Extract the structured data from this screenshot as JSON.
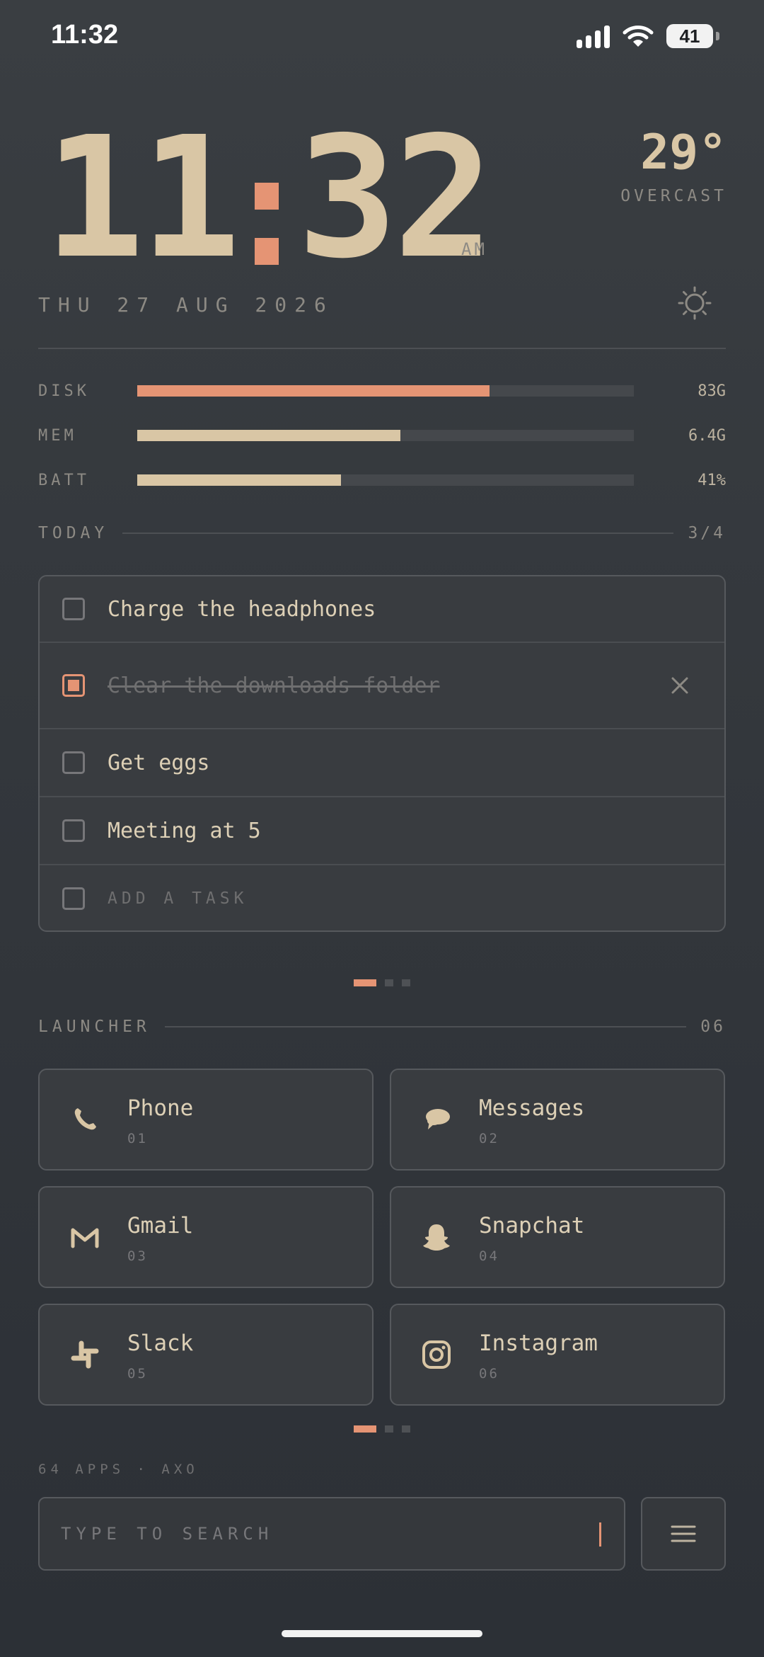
{
  "status_bar": {
    "time": "11:32",
    "battery": "41"
  },
  "clock": {
    "hours": "11",
    "minutes": "32",
    "ampm": "AM"
  },
  "weather": {
    "temp": "29°",
    "condition": "OVERCAST"
  },
  "date": "THU 27 AUG 2026",
  "meters": [
    {
      "label": "DISK",
      "value": "83G",
      "fraction": 0.71,
      "color": "#e59474"
    },
    {
      "label": "MEM",
      "value": "6.4G",
      "fraction": 0.53,
      "color": "#d9c6a5"
    },
    {
      "label": "BATT",
      "value": "41%",
      "fraction": 0.41,
      "color": "#d9c6a5"
    }
  ],
  "today": {
    "label": "TODAY",
    "count": "3/4",
    "tasks": [
      {
        "text": "Charge the headphones",
        "done": false
      },
      {
        "text": "Clear the downloads folder",
        "done": true
      },
      {
        "text": "Get eggs",
        "done": false
      },
      {
        "text": "Meeting at 5",
        "done": false
      }
    ],
    "add_placeholder": "ADD A TASK"
  },
  "launcher": {
    "label": "LAUNCHER",
    "count": "06",
    "apps": [
      {
        "name": "Phone",
        "num": "01",
        "icon": "phone-icon"
      },
      {
        "name": "Messages",
        "num": "02",
        "icon": "messages-icon"
      },
      {
        "name": "Gmail",
        "num": "03",
        "icon": "gmail-icon"
      },
      {
        "name": "Snapchat",
        "num": "04",
        "icon": "snapchat-icon"
      },
      {
        "name": "Slack",
        "num": "05",
        "icon": "slack-icon"
      },
      {
        "name": "Instagram",
        "num": "06",
        "icon": "instagram-icon"
      }
    ]
  },
  "footer": {
    "note": "64 APPS · AXO"
  },
  "search": {
    "placeholder": "TYPE TO SEARCH"
  },
  "colors": {
    "accent": "#e59474",
    "cream": "#d9c6a5",
    "muted": "#8d8a84"
  }
}
